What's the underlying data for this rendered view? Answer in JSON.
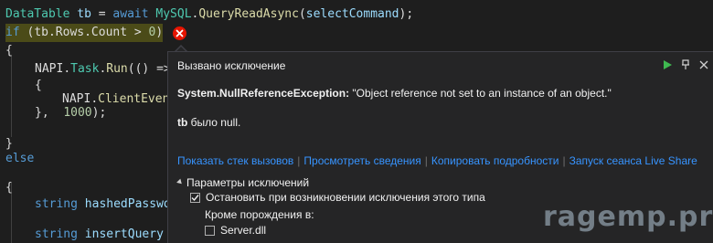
{
  "code": {
    "line1": {
      "type": "DataTable",
      "var": "tb",
      "op": " = ",
      "kw_await": "await",
      "cls": "MySQL",
      "dot": ".",
      "fn": "QueryReadAsync",
      "arg_open": "(",
      "arg": "selectCommand",
      "end": ");"
    },
    "line2": {
      "kw_if": "if",
      "rest_open": " (",
      "expr": "tb.Rows.Count",
      "gt": " > ",
      "num": "0",
      "close": ")"
    },
    "line3": "{",
    "line4": {
      "cls": "NAPI",
      "dot1": ".",
      "task": "Task",
      "dot2": ".",
      "fn": "Run",
      "rest": "(() =>"
    },
    "line5": "{",
    "line6": {
      "cls": "NAPI",
      "dot": ".",
      "fn": "ClientEven"
    },
    "line7": {
      "brace": "},",
      "num": "1000",
      "end": ");"
    },
    "line8": "}",
    "line9": "else",
    "line10": "{",
    "line11": {
      "type": "string",
      "var": "hashedPasswo"
    },
    "line12": {
      "type": "string",
      "var": "insertQuery"
    }
  },
  "popup": {
    "title": "Вызвано исключение",
    "exception_type": "System.NullReferenceException:",
    "exception_message": " \"Object reference not set to an instance of an object.\"",
    "null_var": "tb",
    "null_text": " было null.",
    "links": [
      "Показать стек вызовов",
      "Просмотреть сведения",
      "Копировать подробности",
      "Запуск сеанса Live Share"
    ],
    "settings_title": "Параметры исключений",
    "break_option": "Остановить при возникновении исключения этого типа",
    "break_checked": true,
    "except_label": "Кроме порождения в:",
    "module_option": "Server.dll",
    "module_checked": false
  },
  "watermark": "ragemp.pro",
  "colors": {
    "accent_link": "#3794ff",
    "error": "#e51400",
    "play": "#3fb950"
  }
}
